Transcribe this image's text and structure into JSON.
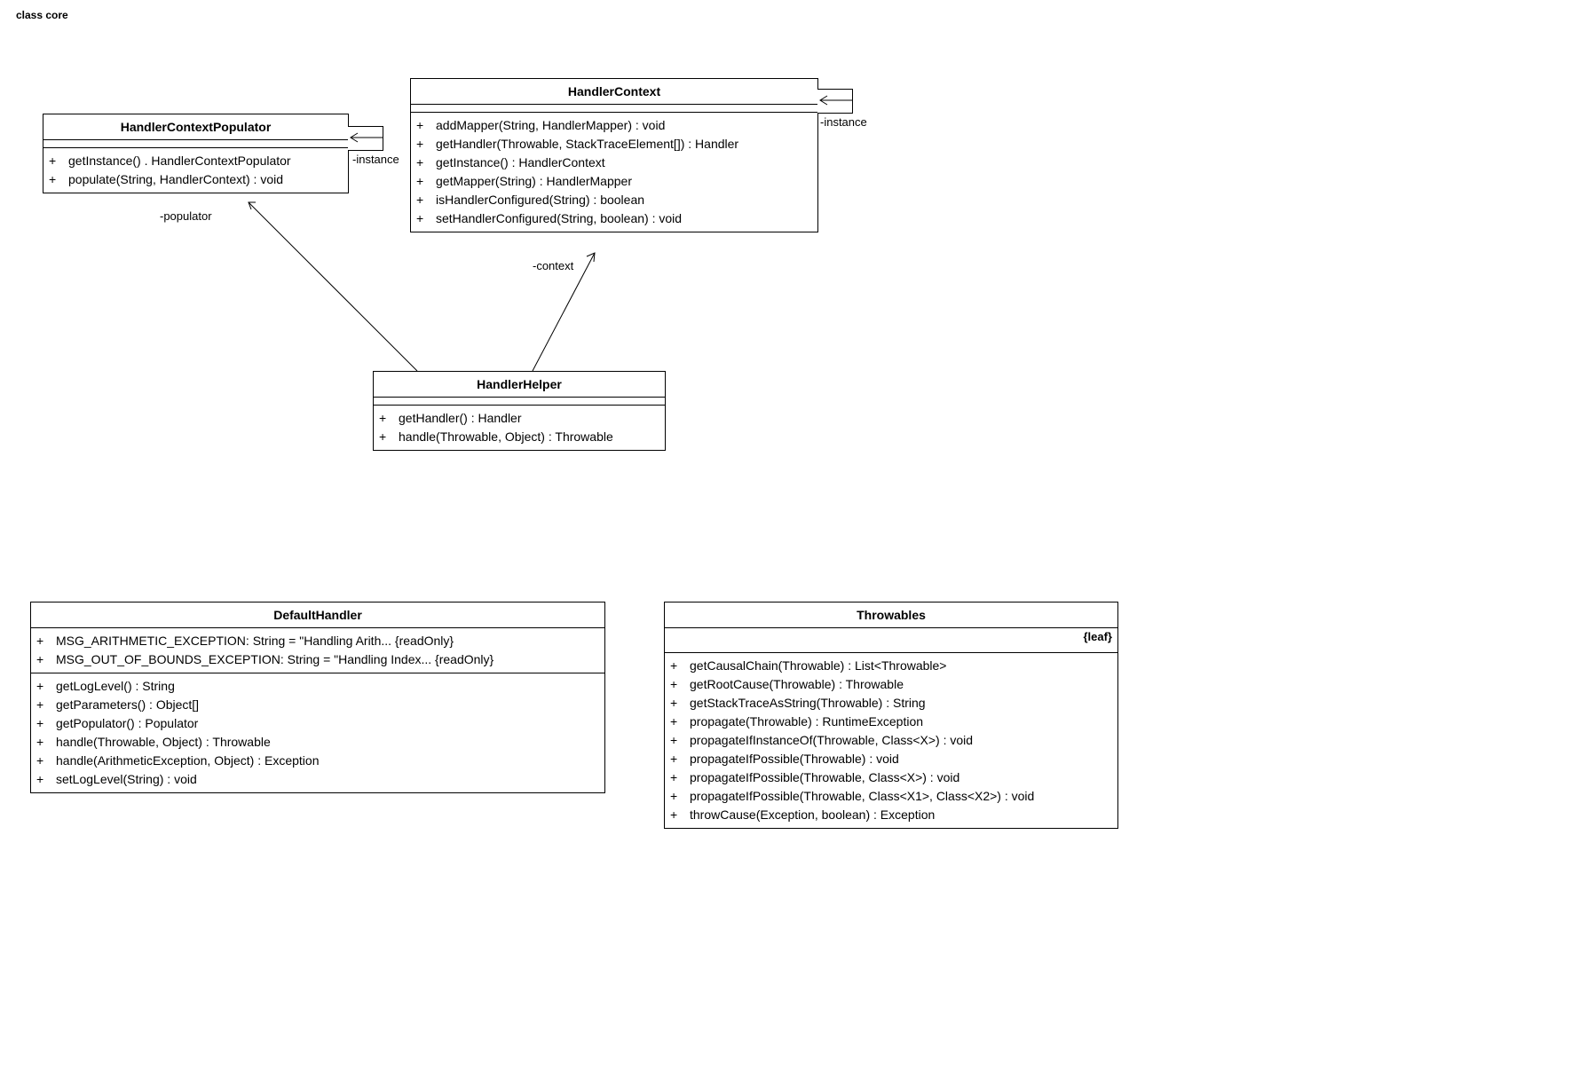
{
  "title": "class core",
  "classes": {
    "hcp": {
      "name": "HandlerContextPopulator",
      "ops": [
        "getInstance() . HandlerContextPopulator",
        "populate(String, HandlerContext) : void"
      ],
      "instanceLabel": "-instance",
      "roleLabel": "-populator"
    },
    "hc": {
      "name": "HandlerContext",
      "ops": [
        "addMapper(String, HandlerMapper) : void",
        "getHandler(Throwable, StackTraceElement[]) : Handler",
        "getInstance() : HandlerContext",
        "getMapper(String) : HandlerMapper",
        "isHandlerConfigured(String) : boolean",
        "setHandlerConfigured(String, boolean) : void"
      ],
      "instanceLabel": "-instance",
      "roleLabel": "-context"
    },
    "hh": {
      "name": "HandlerHelper",
      "ops": [
        "getHandler() : Handler",
        "handle(Throwable, Object) : Throwable"
      ]
    },
    "dh": {
      "name": "DefaultHandler",
      "attrs": [
        "MSG_ARITHMETIC_EXCEPTION: String = \"Handling Arith... {readOnly}",
        "MSG_OUT_OF_BOUNDS_EXCEPTION: String = \"Handling Index... {readOnly}"
      ],
      "ops": [
        "getLogLevel() : String",
        "getParameters() : Object[]",
        "getPopulator() : Populator",
        "handle(Throwable, Object) : Throwable",
        "handle(ArithmeticException, Object) : Exception",
        "setLogLevel(String) : void"
      ]
    },
    "th": {
      "name": "Throwables",
      "stereotype": "{leaf}",
      "ops": [
        "getCausalChain(Throwable) : List<Throwable>",
        "getRootCause(Throwable) : Throwable",
        "getStackTraceAsString(Throwable) : String",
        "propagate(Throwable) : RuntimeException",
        "propagateIfInstanceOf(Throwable, Class<X>) : void",
        "propagateIfPossible(Throwable) : void",
        "propagateIfPossible(Throwable, Class<X>) : void",
        "propagateIfPossible(Throwable, Class<X1>, Class<X2>) : void",
        "throwCause(Exception, boolean) : Exception"
      ]
    }
  }
}
